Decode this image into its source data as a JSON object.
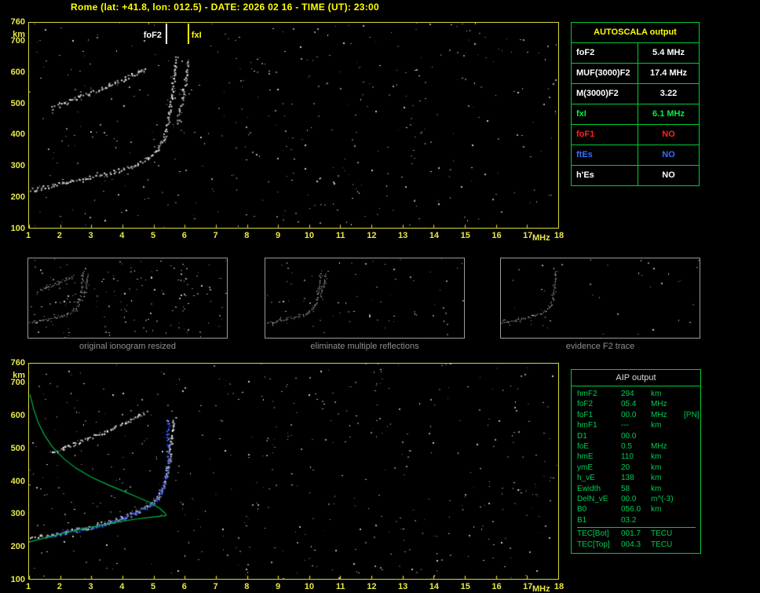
{
  "header": {
    "title": "Rome (lat: +41.8, lon: 012.5) - DATE: 2026 02 16 - TIME (UT): 23:00"
  },
  "autoscala_table": {
    "title": "AUTOSCALA output",
    "rows": [
      {
        "label": "foF2",
        "value": "5.4 MHz",
        "color": "#ffffff"
      },
      {
        "label": "MUF(3000)F2",
        "value": "17.4 MHz",
        "color": "#ffffff"
      },
      {
        "label": "M(3000)F2",
        "value": "3.22",
        "color": "#ffffff"
      },
      {
        "label": "fxI",
        "value": "6.1 MHz",
        "color": "#00ee44"
      },
      {
        "label": "foF1",
        "value": "NO",
        "color": "#ff2222"
      },
      {
        "label": "ftEs",
        "value": "NO",
        "color": "#3a6cff"
      },
      {
        "label": "h'Es",
        "value": "NO",
        "color": "#ffffff"
      }
    ]
  },
  "thumbnails": [
    {
      "caption": "original ionogram resized",
      "series_indices": [
        0,
        1,
        2
      ],
      "noise_dots": 160,
      "seed": 21
    },
    {
      "caption": "eliminate multiple reflections",
      "series_indices": [
        0,
        2
      ],
      "noise_dots": 70,
      "seed": 22
    },
    {
      "caption": "evidence F2 trace",
      "series_indices": [
        0
      ],
      "noise_dots": 40,
      "seed": 23
    }
  ],
  "aip_table": {
    "title": "AIP output",
    "rows": [
      {
        "name": "hmF2",
        "value": "294",
        "unit": "km",
        "note": ""
      },
      {
        "name": "foF2",
        "value": "05.4",
        "unit": "MHz",
        "note": ""
      },
      {
        "name": "foF1",
        "value": "00.0",
        "unit": "MHz",
        "note": "[PN]"
      },
      {
        "name": "hmF1",
        "value": "---",
        "unit": "km",
        "note": ""
      },
      {
        "name": "D1",
        "value": "00.0",
        "unit": "",
        "note": ""
      },
      {
        "name": "foE",
        "value": "0.5",
        "unit": "MHz",
        "note": ""
      },
      {
        "name": "hmE",
        "value": "110",
        "unit": "km",
        "note": ""
      },
      {
        "name": "ymE",
        "value": "20",
        "unit": "km",
        "note": ""
      },
      {
        "name": "h_vE",
        "value": "138",
        "unit": "km",
        "note": ""
      },
      {
        "name": "Ewidth",
        "value": "58",
        "unit": "km",
        "note": ""
      },
      {
        "name": "DelN_vE",
        "value": "00.0",
        "unit": "m^(-3)",
        "note": ""
      },
      {
        "name": "B0",
        "value": "056.0",
        "unit": "km",
        "note": ""
      },
      {
        "name": "B1",
        "value": "03.2",
        "unit": "",
        "note": ""
      }
    ],
    "tec_rows": [
      {
        "name": "TEC[Bot]",
        "value": "001.7",
        "unit": "TECU",
        "note": ""
      },
      {
        "name": "TEC[Top]",
        "value": "004.3",
        "unit": "TECU",
        "note": ""
      }
    ]
  },
  "chart_data": [
    {
      "id": "main_ionogram",
      "type": "scatter",
      "title": "",
      "xlabel": "MHz",
      "ylabel": "km",
      "xlim": [
        1,
        18
      ],
      "ylim": [
        100,
        760
      ],
      "xticks": [
        1,
        2,
        3,
        4,
        5,
        6,
        7,
        8,
        9,
        10,
        11,
        12,
        13,
        14,
        15,
        16,
        17,
        18
      ],
      "yticks": [
        760,
        700,
        600,
        500,
        400,
        300,
        200,
        100
      ],
      "markers": [
        {
          "label": "foF2",
          "x": 5.4,
          "color": "#ffffff",
          "label_side": "left"
        },
        {
          "label": "fxI",
          "x": 6.1,
          "color": "#ffff00",
          "label_side": "right"
        }
      ],
      "series": [
        {
          "name": "F2 trace first order",
          "color": "#ffffff",
          "points": [
            [
              1.0,
              222
            ],
            [
              1.6,
              234
            ],
            [
              2.2,
              246
            ],
            [
              2.8,
              258
            ],
            [
              3.4,
              272
            ],
            [
              3.9,
              286
            ],
            [
              4.4,
              303
            ],
            [
              4.8,
              323
            ],
            [
              5.1,
              349
            ],
            [
              5.3,
              384
            ],
            [
              5.42,
              428
            ],
            [
              5.5,
              472
            ],
            [
              5.55,
              522
            ],
            [
              5.62,
              572
            ],
            [
              5.68,
              622
            ],
            [
              5.72,
              655
            ]
          ]
        },
        {
          "name": "F2 trace second order",
          "color": "#cccccc",
          "points": [
            [
              1.7,
              486
            ],
            [
              2.1,
              503
            ],
            [
              2.5,
              518
            ],
            [
              2.9,
              533
            ],
            [
              3.3,
              549
            ],
            [
              3.7,
              565
            ],
            [
              4.1,
              583
            ],
            [
              4.5,
              601
            ],
            [
              4.75,
              614
            ]
          ]
        },
        {
          "name": "cusp scatter",
          "color": "#bbbbbb",
          "points": [
            [
              5.75,
              440
            ],
            [
              5.85,
              490
            ],
            [
              5.95,
              540
            ],
            [
              6.05,
              590
            ],
            [
              6.12,
              635
            ]
          ]
        }
      ],
      "noise_dots": 430,
      "seed": 7
    },
    {
      "id": "bottom_ionogram_with_profile",
      "type": "scatter",
      "title": "",
      "xlabel": "MHz",
      "ylabel": "km",
      "xlim": [
        1,
        18
      ],
      "ylim": [
        100,
        760
      ],
      "xticks": [
        1,
        2,
        3,
        4,
        5,
        6,
        7,
        8,
        9,
        10,
        11,
        12,
        13,
        14,
        15,
        16,
        17,
        18
      ],
      "yticks": [
        760,
        700,
        600,
        500,
        400,
        300,
        200,
        100
      ],
      "markers": [],
      "series": [
        {
          "name": "F2 trace first order",
          "color": "#ffffff",
          "points": [
            [
              1.0,
              222
            ],
            [
              1.6,
              234
            ],
            [
              2.2,
              246
            ],
            [
              2.8,
              258
            ],
            [
              3.4,
              272
            ],
            [
              3.9,
              286
            ],
            [
              4.4,
              303
            ],
            [
              4.8,
              323
            ],
            [
              5.1,
              349
            ],
            [
              5.3,
              384
            ],
            [
              5.42,
              428
            ],
            [
              5.5,
              472
            ],
            [
              5.55,
              522
            ],
            [
              5.62,
              572
            ],
            [
              5.66,
              592
            ]
          ]
        },
        {
          "name": "F2 trace second order",
          "color": "#cccccc",
          "points": [
            [
              1.7,
              486
            ],
            [
              2.1,
              503
            ],
            [
              2.5,
              518
            ],
            [
              2.9,
              533
            ],
            [
              3.3,
              549
            ],
            [
              3.7,
              565
            ],
            [
              4.1,
              583
            ],
            [
              4.5,
              601
            ],
            [
              4.75,
              614
            ]
          ]
        },
        {
          "name": "restored F2 trace",
          "color": "#3a5cff",
          "points": [
            [
              1.6,
              230
            ],
            [
              2.1,
              241
            ],
            [
              2.6,
              251
            ],
            [
              3.1,
              262
            ],
            [
              3.6,
              274
            ],
            [
              4.0,
              287
            ],
            [
              4.4,
              301
            ],
            [
              4.8,
              320
            ],
            [
              5.1,
              344
            ],
            [
              5.3,
              378
            ],
            [
              5.4,
              420
            ],
            [
              5.45,
              465
            ],
            [
              5.45,
              510
            ],
            [
              5.45,
              555
            ],
            [
              5.45,
              592
            ]
          ]
        }
      ],
      "profiles": [
        {
          "name": "electron density profile bottomside",
          "color": "#00b44a",
          "points": [
            [
              1.0,
              213
            ],
            [
              1.6,
              228
            ],
            [
              2.2,
              242
            ],
            [
              2.8,
              255
            ],
            [
              3.4,
              266
            ],
            [
              3.9,
              275
            ],
            [
              4.4,
              283
            ],
            [
              4.9,
              289
            ],
            [
              5.2,
              292
            ],
            [
              5.4,
              294
            ]
          ]
        },
        {
          "name": "electron density profile topside",
          "color": "#00b44a",
          "points": [
            [
              1.03,
              665
            ],
            [
              1.15,
              620
            ],
            [
              1.3,
              578
            ],
            [
              1.5,
              540
            ],
            [
              1.75,
              505
            ],
            [
              2.1,
              470
            ],
            [
              2.5,
              440
            ],
            [
              3.0,
              412
            ],
            [
              3.5,
              390
            ],
            [
              4.0,
              370
            ],
            [
              4.5,
              350
            ],
            [
              4.9,
              333
            ],
            [
              5.2,
              316
            ],
            [
              5.35,
              303
            ],
            [
              5.42,
              294
            ]
          ]
        }
      ],
      "noise_dots": 480,
      "seed": 13
    }
  ]
}
